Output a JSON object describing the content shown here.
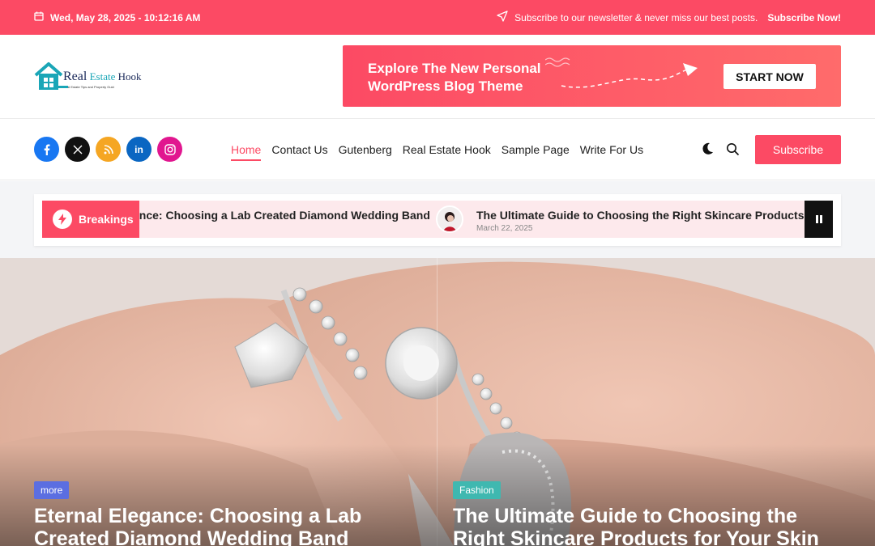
{
  "topbar": {
    "date": "Wed, May 28, 2025 - 10:12:16 AM",
    "newsletter_text": "Subscribe to our newsletter & never miss our best posts.",
    "newsletter_link": "Subscribe Now!"
  },
  "logo": {
    "name_part1": "Real",
    "name_part2": "Estate",
    "name_part3": "Hook",
    "tagline": "Real Estate Tips and Property Guid"
  },
  "banner": {
    "headline": "Explore The New Personal WordPress Blog Theme",
    "cta": "START NOW"
  },
  "socials": [
    {
      "name": "facebook",
      "glyph": "f",
      "color": "#1877f2"
    },
    {
      "name": "x",
      "glyph": "X",
      "color": "#111111"
    },
    {
      "name": "rss",
      "glyph": "◥",
      "color": "#f5a623"
    },
    {
      "name": "linkedin",
      "glyph": "in",
      "color": "#0a66c2"
    },
    {
      "name": "instagram",
      "glyph": "◎",
      "color": "#e1168f"
    }
  ],
  "menu": {
    "items": [
      "Home",
      "Contact Us",
      "Gutenberg",
      "Real Estate Hook",
      "Sample Page",
      "Write For Us"
    ],
    "active": "Home",
    "subscribe": "Subscribe"
  },
  "breaking": {
    "label": "Breakings",
    "item1": "ance: Choosing a Lab Created Diamond Wedding Band",
    "item2": "The Ultimate Guide to Choosing the Right Skincare Products for",
    "item2_date": "March 22, 2025"
  },
  "hero": {
    "posts": [
      {
        "category": "more",
        "category_color": "#5b6ee1",
        "title": "Eternal Elegance: Choosing a Lab Created Diamond Wedding Band"
      },
      {
        "category": "Fashion",
        "category_color": "#3fb8b0",
        "title": "The Ultimate Guide to Choosing the Right Skincare Products for Your Skin Type"
      }
    ]
  },
  "colors": {
    "accent": "#fc4a64",
    "breaking_bg": "#fde9ec"
  }
}
